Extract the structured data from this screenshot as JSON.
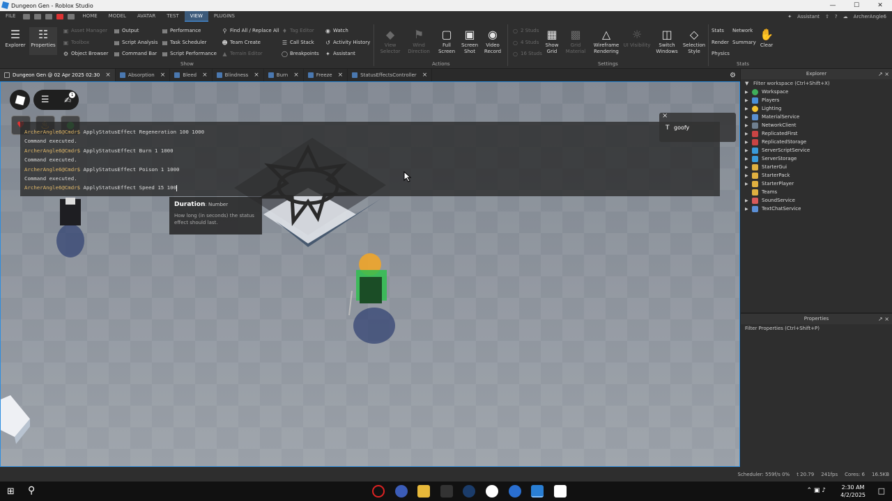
{
  "window": {
    "title": "Dungeon Gen - Roblox Studio"
  },
  "menu": {
    "items": [
      "FILE",
      "HOME",
      "MODEL",
      "AVATAR",
      "TEST",
      "VIEW",
      "PLUGINS"
    ],
    "active": "VIEW",
    "assistant": "Assistant",
    "user": "ArcherAngle6"
  },
  "ribbon": {
    "explorer": "Explorer",
    "properties": "Properties",
    "show_col1": [
      "Asset Manager",
      "Toolbox",
      "Object Browser"
    ],
    "show_col2": [
      "Output",
      "Script Analysis",
      "Command Bar"
    ],
    "show_col3": [
      "Performance",
      "Task Scheduler",
      "Script Performance"
    ],
    "show_col4": [
      "Find All / Replace All",
      "Team Create",
      "Terrain Editor"
    ],
    "show_col5": [
      "Tag Editor",
      "Call Stack",
      "Breakpoints"
    ],
    "show_col6": [
      "Watch",
      "Activity History",
      "Assistant"
    ],
    "show_label": "Show",
    "view_selector": "View Selector",
    "wind_direction": "Wind Direction",
    "full_screen": "Full Screen",
    "screen_shot": "Screen Shot",
    "video_record": "Video Record",
    "actions_label": "Actions",
    "studs": [
      "2 Studs",
      "4 Studs",
      "16 Studs"
    ],
    "show_grid": "Show Grid",
    "grid_material": "Grid Material",
    "wireframe": "Wireframe Rendering",
    "ui_visibility": "UI Visibility",
    "switch_windows": "Switch Windows",
    "selection_style": "Selection Style",
    "settings_label": "Settings",
    "stats_col1": [
      "Stats",
      "Render",
      "Physics"
    ],
    "stats_col2": [
      "Network",
      "Summary"
    ],
    "clear": "Clear",
    "stats_label": "Stats"
  },
  "tabs": [
    {
      "label": "Dungeon Gen @ 02 Apr 2025 02:30"
    },
    {
      "label": "Absorption"
    },
    {
      "label": "Bleed"
    },
    {
      "label": "Blindness"
    },
    {
      "label": "Burn"
    },
    {
      "label": "Freeze"
    },
    {
      "label": "StatusEffectsController"
    }
  ],
  "viewport": {
    "chat_badge": "1",
    "console": [
      {
        "prompt": "ArcherAngle6@Cmdr$ ",
        "cmd": "ApplyStatusEffect Regeneration 100 1000"
      },
      {
        "output": "Command executed."
      },
      {
        "prompt": "ArcherAngle6@Cmdr$ ",
        "cmd": "ApplyStatusEffect Burn 1 1000"
      },
      {
        "output": "Command executed."
      },
      {
        "prompt": "ArcherAngle6@Cmdr$ ",
        "cmd": "ApplyStatusEffect Poison 1 1000"
      },
      {
        "output": "Command executed."
      },
      {
        "prompt": "ArcherAngle6@Cmdr$ ",
        "cmd": "ApplyStatusEffect Speed 15 100"
      }
    ],
    "tooltip": {
      "title": "Duration",
      "type": ": Number",
      "desc": "How long (in seconds) the status effect should last."
    },
    "chat": {
      "name": "goofy"
    }
  },
  "explorer": {
    "title": "Explorer",
    "filter": "Filter workspace (Ctrl+Shift+X)",
    "items": [
      {
        "label": "Workspace",
        "color": "#3fae5a"
      },
      {
        "label": "Players",
        "color": "#4a8fd6"
      },
      {
        "label": "Lighting",
        "color": "#f2c230"
      },
      {
        "label": "MaterialService",
        "color": "#5a8fd0"
      },
      {
        "label": "NetworkClient",
        "color": "#6f7f8f"
      },
      {
        "label": "ReplicatedFirst",
        "color": "#c94444"
      },
      {
        "label": "ReplicatedStorage",
        "color": "#c94444"
      },
      {
        "label": "ServerScriptService",
        "color": "#3a9ad9"
      },
      {
        "label": "ServerStorage",
        "color": "#3a9ad9"
      },
      {
        "label": "StarterGui",
        "color": "#e0b040"
      },
      {
        "label": "StarterPack",
        "color": "#e0b040"
      },
      {
        "label": "StarterPlayer",
        "color": "#e0b040"
      },
      {
        "label": "Teams",
        "color": "#e0b040"
      },
      {
        "label": "SoundService",
        "color": "#d85a5a"
      },
      {
        "label": "TextChatService",
        "color": "#5b8fd6"
      }
    ]
  },
  "properties": {
    "title": "Properties",
    "filter": "Filter Properties (Ctrl+Shift+P)"
  },
  "statusbar": {
    "scheduler": "Scheduler: 559f/s 0%",
    "t": "t 20.79",
    "fps": "241fps",
    "cores": "Cores: 6",
    "mem": "16.5KB"
  },
  "taskbar": {
    "time": "2:30 AM",
    "date": "4/2/2025"
  }
}
